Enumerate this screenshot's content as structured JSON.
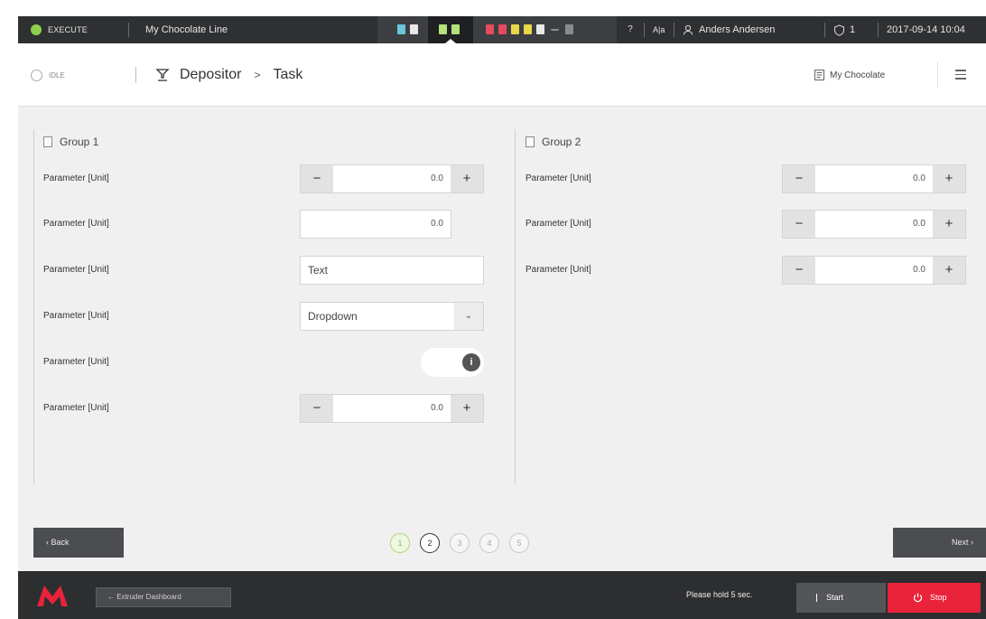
{
  "topbar": {
    "mode": "EXECUTE",
    "line_name": "My Chocolate Line",
    "help": "?",
    "language": "A|a",
    "user": "Anders Andersen",
    "alarm_count": "1",
    "datetime": "2017-09-14  10:04"
  },
  "stations": [
    {
      "icon": "station-cyan-icon",
      "color": "#69c7d9"
    },
    {
      "icon": "station-white-icon",
      "color": "#e8e8e8"
    },
    {
      "icon": "station-green-icon",
      "color": "#b6e07a"
    },
    {
      "icon": "station-green-icon",
      "color": "#b6e07a"
    },
    {
      "icon": "station-red-icon",
      "color": "#e44b5d"
    },
    {
      "icon": "station-red-icon",
      "color": "#e44b5d"
    },
    {
      "icon": "station-yellow-icon",
      "color": "#e6d84a"
    },
    {
      "icon": "station-yellow-icon",
      "color": "#e6d84a"
    },
    {
      "icon": "station-white-icon",
      "color": "#e8e8e8"
    },
    {
      "icon": "station-grey-icon",
      "color": "#8a8b8e"
    }
  ],
  "header": {
    "state": "IDLE",
    "machine": "Depositor",
    "arrow": ">",
    "page": "Task",
    "recipe": "My Chocolate"
  },
  "group1": {
    "title": "Group 1",
    "rows": [
      {
        "label": "Parameter [Unit]",
        "value": "0.0"
      },
      {
        "label": "Parameter [Unit]",
        "value": "0.0"
      },
      {
        "label": "Parameter [Unit]",
        "value": "Text"
      },
      {
        "label": "Parameter [Unit]",
        "value": "Dropdown"
      },
      {
        "label": "Parameter [Unit]",
        "value": "i"
      },
      {
        "label": "Parameter [Unit]",
        "value": "0.0"
      }
    ]
  },
  "group2": {
    "title": "Group 2",
    "rows": [
      {
        "label": "Parameter [Unit]",
        "value": "0.0"
      },
      {
        "label": "Parameter [Unit]",
        "value": "0.0"
      },
      {
        "label": "Parameter [Unit]",
        "value": "0.0"
      }
    ]
  },
  "stepper_minus": "−",
  "stepper_plus": "+",
  "dropdown_chevron": "⌄",
  "nav": {
    "back": "‹  Back",
    "next": "Next  ›",
    "steps": [
      "1",
      "2",
      "3",
      "4",
      "5"
    ],
    "current_step": "2",
    "done_color": "#8cc34b"
  },
  "bottombar": {
    "dashboard": "←  Extruder Dashboard",
    "hold_message": "Please hold 5 sec.",
    "start": "Start",
    "stop": "Stop",
    "stop_color": "#e8233a",
    "logo_color": "#e8233a"
  }
}
